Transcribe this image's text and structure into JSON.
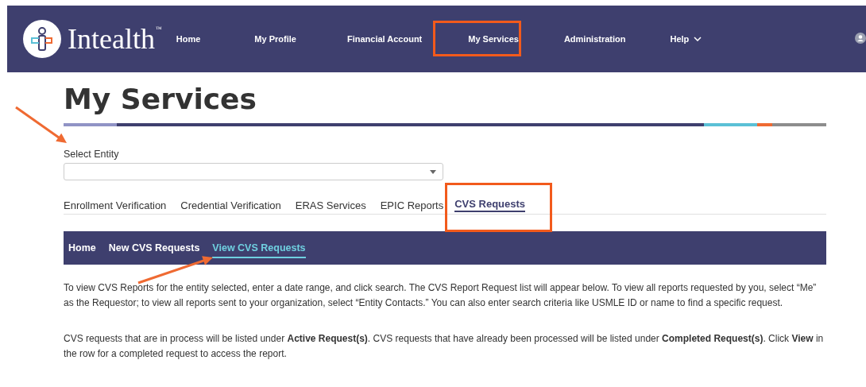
{
  "header": {
    "logo_text": "Intealth",
    "logo_mark": "™",
    "nav": [
      {
        "label": "Home",
        "has_menu": false
      },
      {
        "label": "My Profile",
        "has_menu": false
      },
      {
        "label": "Financial Account",
        "has_menu": false
      },
      {
        "label": "My Services",
        "has_menu": false
      },
      {
        "label": "Administration",
        "has_menu": false
      },
      {
        "label": "Help",
        "has_menu": true
      }
    ]
  },
  "page_title": "My Services",
  "entity_select": {
    "label": "Select Entity"
  },
  "tabs": [
    {
      "label": "Enrollment Verification",
      "selected": false
    },
    {
      "label": "Credential Verification",
      "selected": false
    },
    {
      "label": "ERAS Services",
      "selected": false
    },
    {
      "label": "EPIC Reports",
      "selected": false
    },
    {
      "label": "CVS Requests",
      "selected": true
    }
  ],
  "subnav": [
    {
      "label": "Home",
      "selected": false
    },
    {
      "label": "New CVS Requests",
      "selected": false
    },
    {
      "label": "View CVS Requests",
      "selected": true
    }
  ],
  "paragraphs": [
    "To view CVS Reports for the entity selected, enter a date range, and click search. The CVS Report Request list will appear below. To view all reports requested by you, select “Me” as the Requestor; to view all reports sent to your organization, select “Entity Contacts.” You can also enter search criteria like USMLE ID or name to find a specific request.",
    "CVS requests that are in process will be listed under **Active Request(s)**. CVS requests that have already been processed will be listed under **Completed Request(s)**. Click **View** in the row for a completed request to access the report."
  ]
}
